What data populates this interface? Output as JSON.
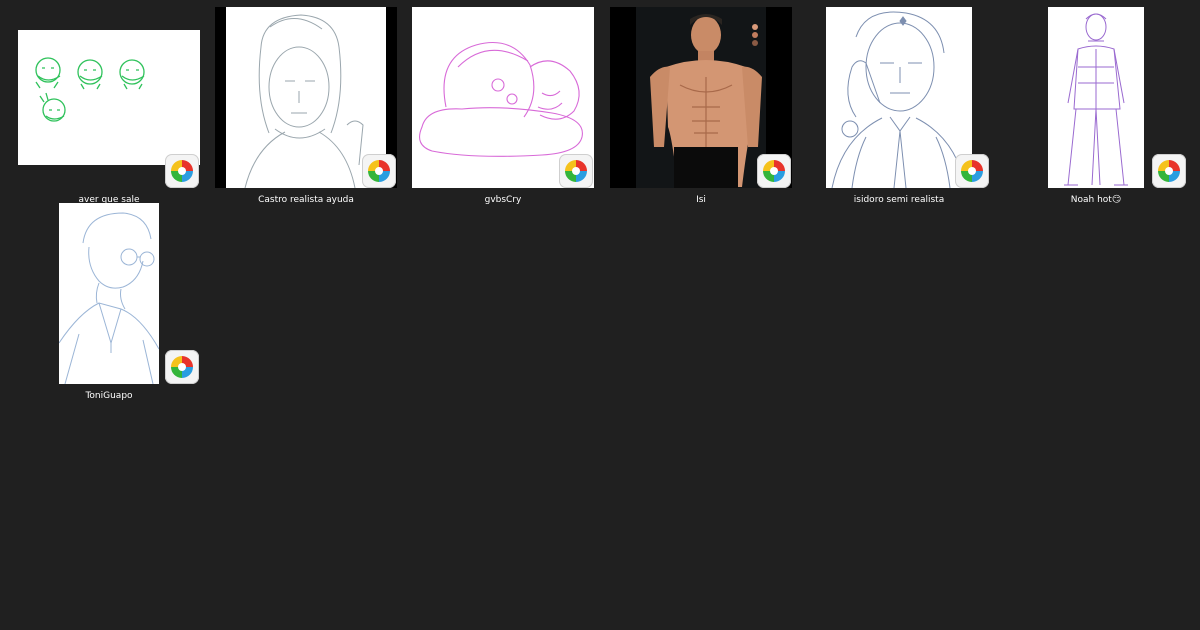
{
  "files": [
    {
      "name": "aver que sale",
      "app_icon": "medibang-paint-icon"
    },
    {
      "name": "Castro realista ayuda",
      "app_icon": "medibang-paint-icon"
    },
    {
      "name": "gvbsCry",
      "app_icon": "medibang-paint-icon"
    },
    {
      "name": "Isi",
      "app_icon": "medibang-paint-icon"
    },
    {
      "name": "isidoro semi realista",
      "app_icon": "medibang-paint-icon"
    },
    {
      "name": "Noah hot😏",
      "app_icon": "medibang-paint-icon"
    },
    {
      "name": "ToniGuapo",
      "app_icon": "medibang-paint-icon"
    }
  ]
}
